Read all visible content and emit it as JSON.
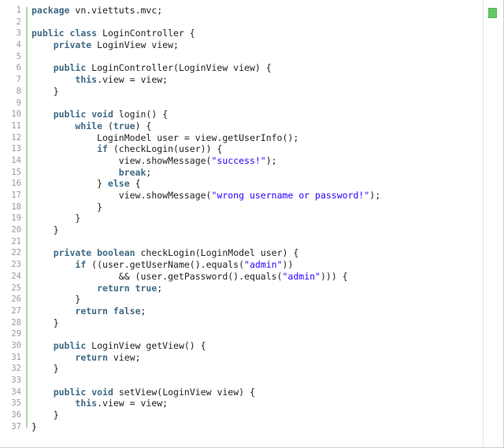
{
  "editor": {
    "language": "java",
    "first_line": 1,
    "last_line": 37,
    "gutter_separator_color": "#a8d8a8",
    "keyword_color": "#3f6a86",
    "string_color": "#2a00ff",
    "text_color": "#222222",
    "line_number_color": "#9a9a9a",
    "background_color": "#ffffff"
  },
  "overview_ruler": {
    "marker_label": "",
    "marker_color": "#63c963",
    "marker_name": "no-errors-marker"
  },
  "code": {
    "lines": [
      {
        "number": "1",
        "tokens": [
          {
            "t": "keyword",
            "s": "package"
          },
          {
            "t": "plain",
            "s": " vn.viettuts.mvc;"
          }
        ]
      },
      {
        "number": "2",
        "tokens": []
      },
      {
        "number": "3",
        "tokens": [
          {
            "t": "keyword",
            "s": "public"
          },
          {
            "t": "plain",
            "s": " "
          },
          {
            "t": "keyword",
            "s": "class"
          },
          {
            "t": "plain",
            "s": " LoginController {"
          }
        ]
      },
      {
        "number": "4",
        "tokens": [
          {
            "t": "plain",
            "s": "    "
          },
          {
            "t": "keyword",
            "s": "private"
          },
          {
            "t": "plain",
            "s": " LoginView view;"
          }
        ]
      },
      {
        "number": "5",
        "tokens": []
      },
      {
        "number": "6",
        "tokens": [
          {
            "t": "plain",
            "s": "    "
          },
          {
            "t": "keyword",
            "s": "public"
          },
          {
            "t": "plain",
            "s": " LoginController(LoginView view) {"
          }
        ]
      },
      {
        "number": "7",
        "tokens": [
          {
            "t": "plain",
            "s": "        "
          },
          {
            "t": "keyword",
            "s": "this"
          },
          {
            "t": "plain",
            "s": ".view = view;"
          }
        ]
      },
      {
        "number": "8",
        "tokens": [
          {
            "t": "plain",
            "s": "    }"
          }
        ]
      },
      {
        "number": "9",
        "tokens": []
      },
      {
        "number": "10",
        "tokens": [
          {
            "t": "plain",
            "s": "    "
          },
          {
            "t": "keyword",
            "s": "public"
          },
          {
            "t": "plain",
            "s": " "
          },
          {
            "t": "keyword",
            "s": "void"
          },
          {
            "t": "plain",
            "s": " login() {"
          }
        ]
      },
      {
        "number": "11",
        "tokens": [
          {
            "t": "plain",
            "s": "        "
          },
          {
            "t": "keyword",
            "s": "while"
          },
          {
            "t": "plain",
            "s": " ("
          },
          {
            "t": "keyword",
            "s": "true"
          },
          {
            "t": "plain",
            "s": ") {"
          }
        ]
      },
      {
        "number": "12",
        "tokens": [
          {
            "t": "plain",
            "s": "            LoginModel user = view.getUserInfo();"
          }
        ]
      },
      {
        "number": "13",
        "tokens": [
          {
            "t": "plain",
            "s": "            "
          },
          {
            "t": "keyword",
            "s": "if"
          },
          {
            "t": "plain",
            "s": " (checkLogin(user)) {"
          }
        ]
      },
      {
        "number": "14",
        "tokens": [
          {
            "t": "plain",
            "s": "                view.showMessage("
          },
          {
            "t": "string",
            "s": "\"success!\""
          },
          {
            "t": "plain",
            "s": ");"
          }
        ]
      },
      {
        "number": "15",
        "tokens": [
          {
            "t": "plain",
            "s": "                "
          },
          {
            "t": "keyword",
            "s": "break"
          },
          {
            "t": "plain",
            "s": ";"
          }
        ]
      },
      {
        "number": "16",
        "tokens": [
          {
            "t": "plain",
            "s": "            } "
          },
          {
            "t": "keyword",
            "s": "else"
          },
          {
            "t": "plain",
            "s": " {"
          }
        ]
      },
      {
        "number": "17",
        "tokens": [
          {
            "t": "plain",
            "s": "                view.showMessage("
          },
          {
            "t": "string",
            "s": "\"wrong username or password!\""
          },
          {
            "t": "plain",
            "s": ");"
          }
        ]
      },
      {
        "number": "18",
        "tokens": [
          {
            "t": "plain",
            "s": "            }"
          }
        ]
      },
      {
        "number": "19",
        "tokens": [
          {
            "t": "plain",
            "s": "        }"
          }
        ]
      },
      {
        "number": "20",
        "tokens": [
          {
            "t": "plain",
            "s": "    }"
          }
        ]
      },
      {
        "number": "21",
        "tokens": []
      },
      {
        "number": "22",
        "tokens": [
          {
            "t": "plain",
            "s": "    "
          },
          {
            "t": "keyword",
            "s": "private"
          },
          {
            "t": "plain",
            "s": " "
          },
          {
            "t": "keyword",
            "s": "boolean"
          },
          {
            "t": "plain",
            "s": " checkLogin(LoginModel user) {"
          }
        ]
      },
      {
        "number": "23",
        "tokens": [
          {
            "t": "plain",
            "s": "        "
          },
          {
            "t": "keyword",
            "s": "if"
          },
          {
            "t": "plain",
            "s": " ((user.getUserName().equals("
          },
          {
            "t": "string",
            "s": "\"admin\""
          },
          {
            "t": "plain",
            "s": "))"
          }
        ]
      },
      {
        "number": "24",
        "tokens": [
          {
            "t": "plain",
            "s": "                && (user.getPassword().equals("
          },
          {
            "t": "string",
            "s": "\"admin\""
          },
          {
            "t": "plain",
            "s": "))) {"
          }
        ]
      },
      {
        "number": "25",
        "tokens": [
          {
            "t": "plain",
            "s": "            "
          },
          {
            "t": "keyword",
            "s": "return"
          },
          {
            "t": "plain",
            "s": " "
          },
          {
            "t": "keyword",
            "s": "true"
          },
          {
            "t": "plain",
            "s": ";"
          }
        ]
      },
      {
        "number": "26",
        "tokens": [
          {
            "t": "plain",
            "s": "        }"
          }
        ]
      },
      {
        "number": "27",
        "tokens": [
          {
            "t": "plain",
            "s": "        "
          },
          {
            "t": "keyword",
            "s": "return"
          },
          {
            "t": "plain",
            "s": " "
          },
          {
            "t": "keyword",
            "s": "false"
          },
          {
            "t": "plain",
            "s": ";"
          }
        ]
      },
      {
        "number": "28",
        "tokens": [
          {
            "t": "plain",
            "s": "    }"
          }
        ]
      },
      {
        "number": "29",
        "tokens": []
      },
      {
        "number": "30",
        "tokens": [
          {
            "t": "plain",
            "s": "    "
          },
          {
            "t": "keyword",
            "s": "public"
          },
          {
            "t": "plain",
            "s": " LoginView getView() {"
          }
        ]
      },
      {
        "number": "31",
        "tokens": [
          {
            "t": "plain",
            "s": "        "
          },
          {
            "t": "keyword",
            "s": "return"
          },
          {
            "t": "plain",
            "s": " view;"
          }
        ]
      },
      {
        "number": "32",
        "tokens": [
          {
            "t": "plain",
            "s": "    }"
          }
        ]
      },
      {
        "number": "33",
        "tokens": []
      },
      {
        "number": "34",
        "tokens": [
          {
            "t": "plain",
            "s": "    "
          },
          {
            "t": "keyword",
            "s": "public"
          },
          {
            "t": "plain",
            "s": " "
          },
          {
            "t": "keyword",
            "s": "void"
          },
          {
            "t": "plain",
            "s": " setView(LoginView view) {"
          }
        ]
      },
      {
        "number": "35",
        "tokens": [
          {
            "t": "plain",
            "s": "        "
          },
          {
            "t": "keyword",
            "s": "this"
          },
          {
            "t": "plain",
            "s": ".view = view;"
          }
        ]
      },
      {
        "number": "36",
        "tokens": [
          {
            "t": "plain",
            "s": "    }"
          }
        ]
      },
      {
        "number": "37",
        "tokens": [
          {
            "t": "plain",
            "s": "}"
          }
        ]
      }
    ]
  }
}
